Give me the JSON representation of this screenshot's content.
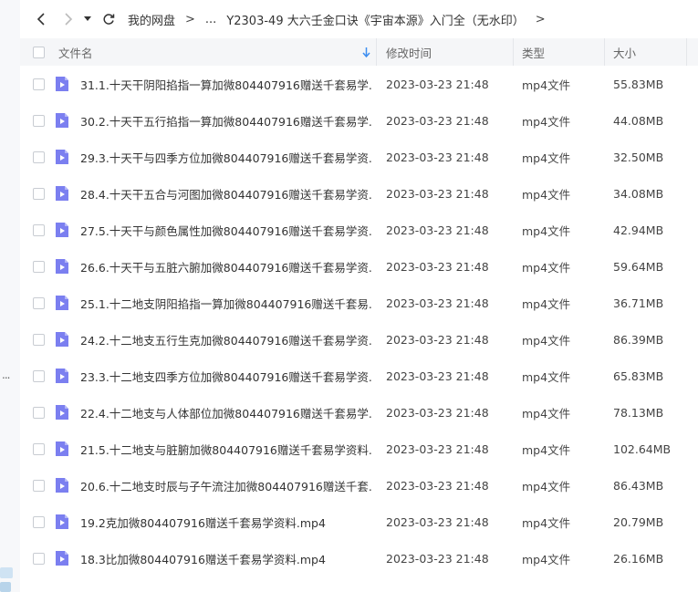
{
  "toolbar": {
    "breadcrumbs": {
      "root": "我的网盘",
      "sep1": ">",
      "ellipsis": "...",
      "current": "Y2303-49 大六壬金口诀《宇宙本源》入门全（无水印）",
      "sep2": ">"
    }
  },
  "table": {
    "headers": {
      "name": "文件名",
      "date": "修改时间",
      "type": "类型",
      "size": "大小"
    },
    "rows": [
      {
        "name": "31.1.十天干阴阳掐指一算加微804407916赠送千套易学...",
        "date": "2023-03-23 21:48",
        "type": "mp4文件",
        "size": "55.83MB"
      },
      {
        "name": "30.2.十天干五行掐指一算加微804407916赠送千套易学...",
        "date": "2023-03-23 21:48",
        "type": "mp4文件",
        "size": "44.08MB"
      },
      {
        "name": "29.3.十天干与四季方位加微804407916赠送千套易学资...",
        "date": "2023-03-23 21:48",
        "type": "mp4文件",
        "size": "32.50MB"
      },
      {
        "name": "28.4.十天干五合与河图加微804407916赠送千套易学资...",
        "date": "2023-03-23 21:48",
        "type": "mp4文件",
        "size": "34.08MB"
      },
      {
        "name": "27.5.十天干与颜色属性加微804407916赠送千套易学资...",
        "date": "2023-03-23 21:48",
        "type": "mp4文件",
        "size": "42.94MB"
      },
      {
        "name": "26.6.十天干与五脏六腑加微804407916赠送千套易学资...",
        "date": "2023-03-23 21:48",
        "type": "mp4文件",
        "size": "59.64MB"
      },
      {
        "name": "25.1.十二地支阴阳掐指一算加微804407916赠送千套易...",
        "date": "2023-03-23 21:48",
        "type": "mp4文件",
        "size": "36.71MB"
      },
      {
        "name": "24.2.十二地支五行生克加微804407916赠送千套易学资...",
        "date": "2023-03-23 21:48",
        "type": "mp4文件",
        "size": "86.39MB"
      },
      {
        "name": "23.3.十二地支四季方位加微804407916赠送千套易学资...",
        "date": "2023-03-23 21:48",
        "type": "mp4文件",
        "size": "65.83MB"
      },
      {
        "name": "22.4.十二地支与人体部位加微804407916赠送千套易学...",
        "date": "2023-03-23 21:48",
        "type": "mp4文件",
        "size": "78.13MB"
      },
      {
        "name": "21.5.十二地支与脏腑加微804407916赠送千套易学资料....",
        "date": "2023-03-23 21:48",
        "type": "mp4文件",
        "size": "102.64MB"
      },
      {
        "name": "20.6.十二地支时辰与子午流注加微804407916赠送千套...",
        "date": "2023-03-23 21:48",
        "type": "mp4文件",
        "size": "86.43MB"
      },
      {
        "name": "19.2克加微804407916赠送千套易学资料.mp4",
        "date": "2023-03-23 21:48",
        "type": "mp4文件",
        "size": "20.79MB"
      },
      {
        "name": "18.3比加微804407916赠送千套易学资料.mp4",
        "date": "2023-03-23 21:48",
        "type": "mp4文件",
        "size": "26.16MB"
      }
    ]
  },
  "side": {
    "dots": "..."
  },
  "colors": {
    "icon_purple": "#7b7ff0",
    "sort_arrow": "#3d8ef0"
  }
}
